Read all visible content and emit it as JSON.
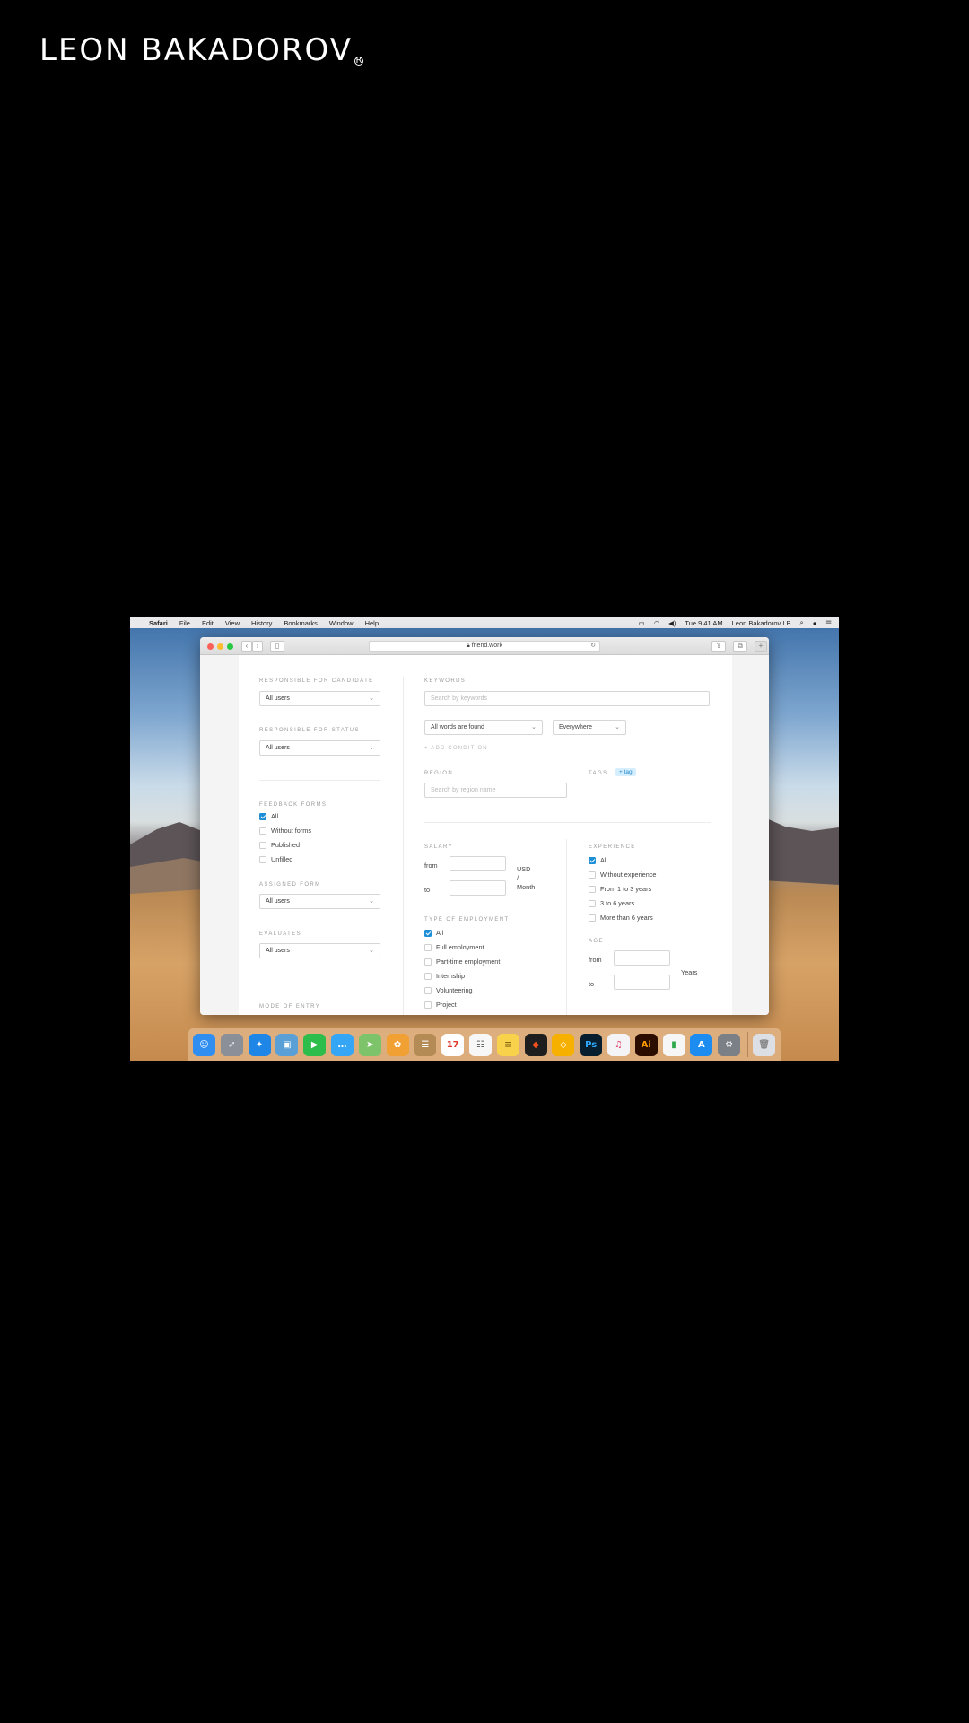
{
  "brand": {
    "name": "LEON BAKADOROV",
    "mark": "R"
  },
  "menubar": {
    "items": [
      "Safari",
      "File",
      "Edit",
      "View",
      "History",
      "Bookmarks",
      "Window",
      "Help"
    ],
    "clock": "Tue 9:41 AM",
    "user": "Leon Bakadorov LB"
  },
  "browser": {
    "url": "friend.work"
  },
  "filters": {
    "responsible_candidate": {
      "label": "RESPONSIBLE FOR CANDIDATE",
      "value": "All users"
    },
    "responsible_status": {
      "label": "RESPONSIBLE FOR STATUS",
      "value": "All users"
    },
    "feedback_forms": {
      "label": "FEEDBACK FORMS",
      "options": [
        {
          "label": "All",
          "checked": true
        },
        {
          "label": "Without forms",
          "checked": false
        },
        {
          "label": "Published",
          "checked": false
        },
        {
          "label": "Unfilled",
          "checked": false
        }
      ]
    },
    "assigned_form": {
      "label": "ASSIGNED FORM",
      "value": "All users"
    },
    "evaluates": {
      "label": "EVALUATES",
      "value": "All users"
    },
    "mode_of_entry": {
      "label": "MODE OF ENTRY"
    },
    "keywords": {
      "label": "KEYWORDS",
      "placeholder": "Search by keywords"
    },
    "match_mode": {
      "value": "All words are found"
    },
    "scope": {
      "value": "Everywhere"
    },
    "add_condition": "+ ADD CONDITION",
    "region": {
      "label": "REGION",
      "placeholder": "Search by region name"
    },
    "tags": {
      "label": "TAGS",
      "add": "+ tag"
    },
    "salary": {
      "label": "SALARY",
      "from": "from",
      "to": "to",
      "unit1": "USD",
      "unit2": "/",
      "unit3": "Month"
    },
    "employment": {
      "label": "TYPE OF EMPLOYMENT",
      "options": [
        {
          "label": "All",
          "checked": true
        },
        {
          "label": "Full employment",
          "checked": false
        },
        {
          "label": "Part-time employment",
          "checked": false
        },
        {
          "label": "Internship",
          "checked": false
        },
        {
          "label": "Volunteering",
          "checked": false
        },
        {
          "label": "Project",
          "checked": false
        }
      ]
    },
    "experience": {
      "label": "EXPERIENCE",
      "options": [
        {
          "label": "All",
          "checked": true
        },
        {
          "label": "Without experience",
          "checked": false
        },
        {
          "label": "From 1 to 3 years",
          "checked": false
        },
        {
          "label": "3 to 6 years",
          "checked": false
        },
        {
          "label": "More than 6 years",
          "checked": false
        }
      ]
    },
    "age": {
      "label": "AGE",
      "from": "from",
      "to": "to",
      "unit": "Years"
    }
  },
  "dock": {
    "apps": [
      {
        "name": "finder",
        "color": "#2f8ef0",
        "glyph": "☺"
      },
      {
        "name": "launchpad",
        "color": "#8a8f98",
        "glyph": "➶"
      },
      {
        "name": "safari",
        "color": "#1e86e6",
        "glyph": "✦"
      },
      {
        "name": "preview",
        "color": "#5aa0d6",
        "glyph": "▣"
      },
      {
        "name": "facetime",
        "color": "#2dbd4a",
        "glyph": "▶"
      },
      {
        "name": "messages",
        "color": "#35a6f5",
        "glyph": "…"
      },
      {
        "name": "maps",
        "color": "#7cc36a",
        "glyph": "➤"
      },
      {
        "name": "photos",
        "color": "#f1a033",
        "glyph": "✿"
      },
      {
        "name": "contacts",
        "color": "#b48a55",
        "glyph": "☰"
      },
      {
        "name": "calendar",
        "color": "#ffffff",
        "glyph": "17",
        "fg": "#e03a2d"
      },
      {
        "name": "reminders",
        "color": "#f7f7f7",
        "glyph": "☷",
        "fg": "#666"
      },
      {
        "name": "notes",
        "color": "#f8d24a",
        "glyph": "≡",
        "fg": "#8a6a10"
      },
      {
        "name": "figma",
        "color": "#1e1e1e",
        "glyph": "◆",
        "fg": "#f24e1e"
      },
      {
        "name": "sketch",
        "color": "#f5b000",
        "glyph": "◇"
      },
      {
        "name": "photoshop",
        "color": "#061e2d",
        "glyph": "Ps",
        "fg": "#31a8ff"
      },
      {
        "name": "itunes",
        "color": "#f4f4f6",
        "glyph": "♫",
        "fg": "#e2456f"
      },
      {
        "name": "illustrator",
        "color": "#2b0d00",
        "glyph": "Ai",
        "fg": "#ff9a00"
      },
      {
        "name": "numbers",
        "color": "#f6f6f6",
        "glyph": "▮",
        "fg": "#2ba84a"
      },
      {
        "name": "app-store",
        "color": "#1c8cf0",
        "glyph": "A"
      },
      {
        "name": "system-preferences",
        "color": "#7b7f86",
        "glyph": "⚙"
      }
    ],
    "trash": {
      "name": "trash",
      "color": "#dcdfe3",
      "glyph": "🗑"
    }
  }
}
